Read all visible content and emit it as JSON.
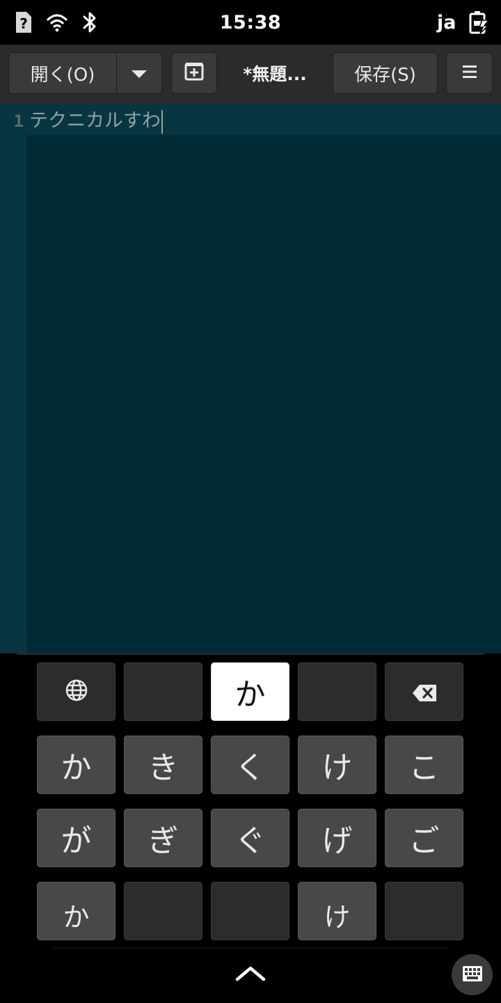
{
  "statusbar": {
    "time": "15:38",
    "lang": "ja",
    "icons": [
      "sim-unknown-icon",
      "wifi-icon",
      "bluetooth-icon",
      "battery-charging-icon"
    ]
  },
  "header": {
    "open_label": "開く(O)",
    "title": "*無題...",
    "save_label": "保存(S)",
    "icons": [
      "chevron-down-icon",
      "new-tab-icon",
      "hamburger-menu-icon"
    ]
  },
  "editor": {
    "line_numbers": [
      "1"
    ],
    "lines": [
      "テクニカルすわ"
    ]
  },
  "keyboard": {
    "rows": [
      [
        "globe-icon",
        "",
        "か",
        "",
        "backspace-icon"
      ],
      [
        "か",
        "き",
        "く",
        "け",
        "こ"
      ],
      [
        "が",
        "ぎ",
        "ぐ",
        "げ",
        "ご"
      ],
      [
        "か",
        "",
        "",
        "け",
        ""
      ]
    ],
    "popup_key": "か",
    "bottom_icons": [
      "chevron-up-icon",
      "keyboard-icon"
    ]
  },
  "colors": {
    "editor_bg": "#002b36",
    "current_line_bg": "#073642",
    "header_bg": "#2b2b2e",
    "key_bg": "#48484a"
  }
}
